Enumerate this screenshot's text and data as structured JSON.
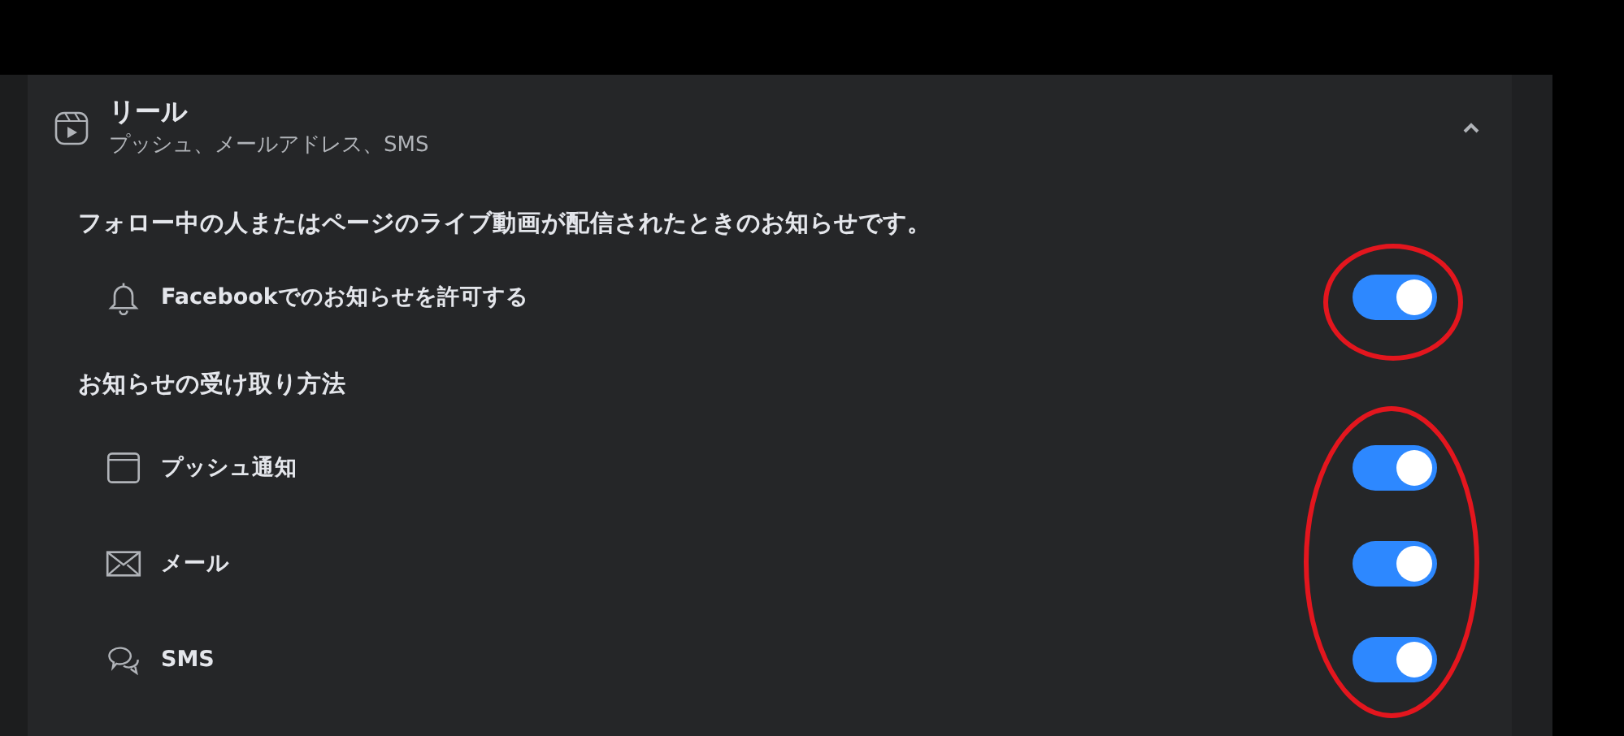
{
  "section": {
    "title": "リール",
    "subtitle": "プッシュ、メールアドレス、SMS",
    "expanded": true
  },
  "description": "フォロー中の人またはページのライブ動画が配信されたときのお知らせです。",
  "allow_row": {
    "label": "Facebookでのお知らせを許可する",
    "on": true
  },
  "methods_heading": "お知らせの受け取り方法",
  "methods": [
    {
      "kind": "push",
      "label": "プッシュ通知",
      "on": true
    },
    {
      "kind": "email",
      "label": "メール",
      "on": true
    },
    {
      "kind": "sms",
      "label": "SMS",
      "on": true
    }
  ],
  "annotations": [
    {
      "kind": "ellipse"
    },
    {
      "kind": "ellipse"
    }
  ]
}
